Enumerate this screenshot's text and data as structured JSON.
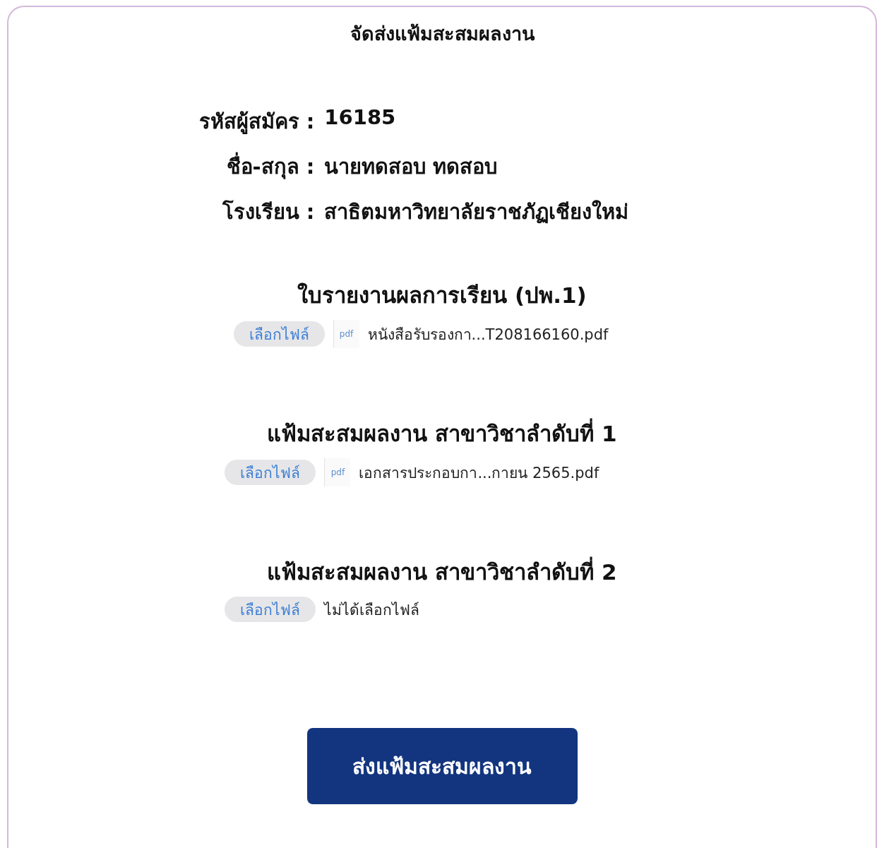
{
  "title": "จัดส่งแฟ้มสะสมผลงาน",
  "applicant": [
    {
      "label": "รหัสผู้สมัคร :",
      "value": "16185"
    },
    {
      "label": "ชื่อ-สกุล :",
      "value": "นายทดสอบ  ทดสอบ"
    },
    {
      "label": "โรงเรียน :",
      "value": "สาธิตมหาวิทยาลัยราชภัฏเชียงใหม่"
    }
  ],
  "uploads": [
    {
      "heading": "ใบรายงานผลการเรียน (ปพ.1)",
      "button": "เลือกไฟล์",
      "kind": "file",
      "icon_label": "pdf",
      "file_name": "หนังสือรับรองกา...T208166160.pdf"
    },
    {
      "heading": "แฟ้มสะสมผลงาน สาขาวิชาลำดับที่ 1",
      "button": "เลือกไฟล์",
      "kind": "file",
      "icon_label": "pdf",
      "file_name": "เอกสารประกอบกา...กายน 2565.pdf"
    },
    {
      "heading": "แฟ้มสะสมผลงาน สาขาวิชาลำดับที่ 2",
      "button": "เลือกไฟล์",
      "kind": "empty",
      "file_name": "ไม่ได้เลือกไฟล์"
    }
  ],
  "submit": "ส่งแฟ้มสะสมผลงาน"
}
